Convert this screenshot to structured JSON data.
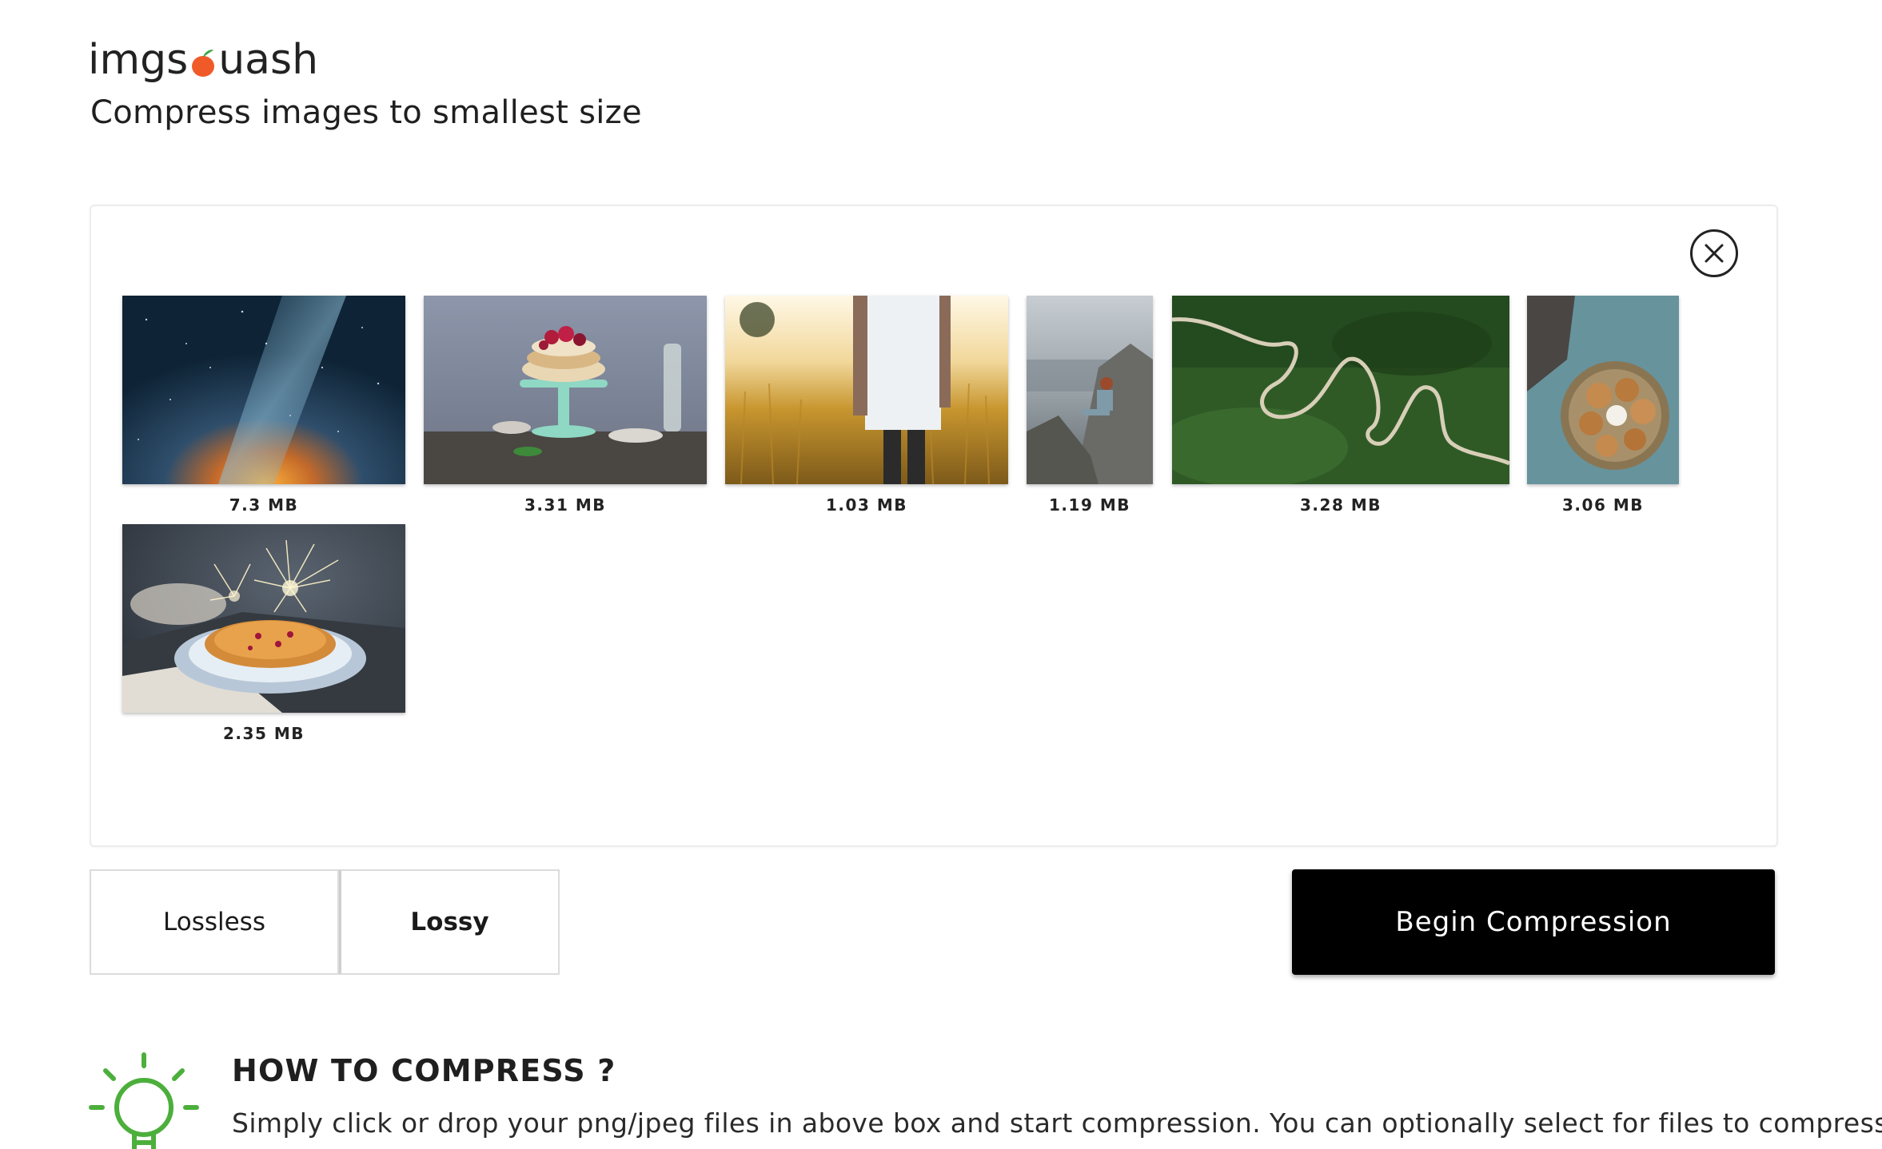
{
  "brand": {
    "logo_left": "imgs",
    "logo_right": "uash",
    "tagline": "Compress images to smallest size"
  },
  "dropzone": {
    "images": [
      {
        "size": "7.3 MB",
        "subject": "milky-way-night-sky"
      },
      {
        "size": "3.31 MB",
        "subject": "layered-cake-on-stand"
      },
      {
        "size": "1.03 MB",
        "subject": "person-in-wheat-field"
      },
      {
        "size": "1.19 MB",
        "subject": "woman-on-sea-cliff"
      },
      {
        "size": "3.28 MB",
        "subject": "winding-mountain-road"
      },
      {
        "size": "3.06 MB",
        "subject": "cookies-in-bowl"
      },
      {
        "size": "2.35 MB",
        "subject": "pie-with-sparklers"
      }
    ]
  },
  "controls": {
    "lossless_label": "Lossless",
    "lossy_label": "Lossy",
    "selected_mode": "Lossy",
    "begin_label": "Begin Compression"
  },
  "howto": {
    "title": "HOW TO COMPRESS ?",
    "text": "Simply click or drop your png/jpeg files in above box and start compression. You can optionally select for files to compress with"
  },
  "colors": {
    "accent_orange": "#f05a28",
    "icon_green": "#4caf3c",
    "button_black": "#000000"
  }
}
